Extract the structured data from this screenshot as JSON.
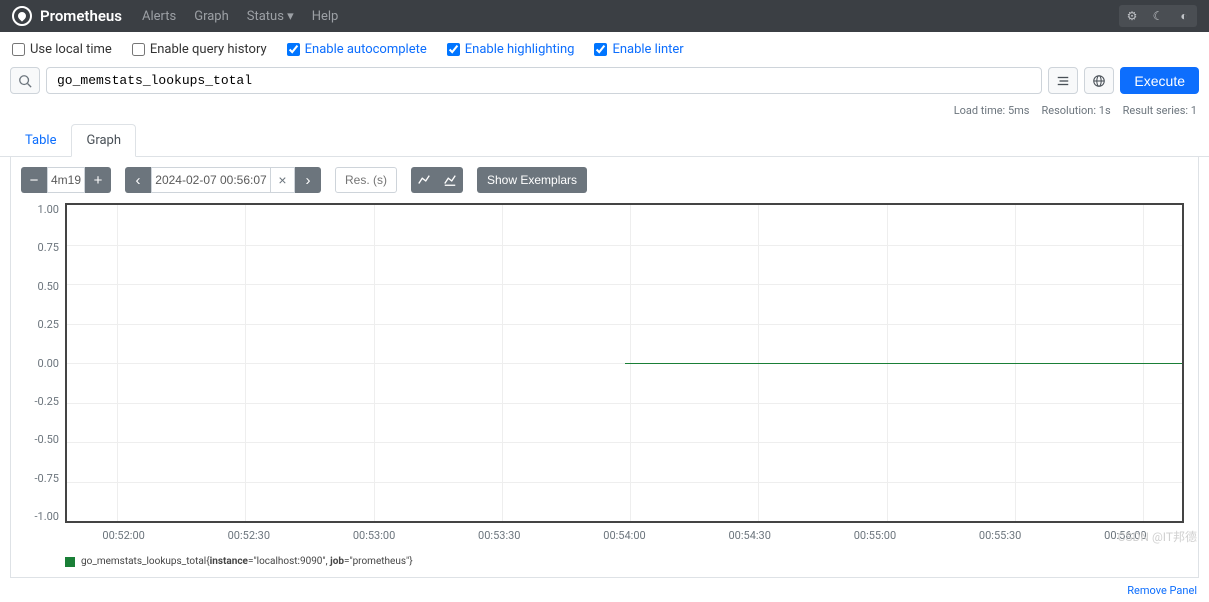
{
  "navbar": {
    "brand": "Prometheus",
    "links": [
      "Alerts",
      "Graph",
      "Status",
      "Help"
    ]
  },
  "options": {
    "use_local_time": {
      "label": "Use local time",
      "checked": false
    },
    "enable_query_history": {
      "label": "Enable query history",
      "checked": false
    },
    "enable_autocomplete": {
      "label": "Enable autocomplete",
      "checked": true
    },
    "enable_highlighting": {
      "label": "Enable highlighting",
      "checked": true
    },
    "enable_linter": {
      "label": "Enable linter",
      "checked": true
    }
  },
  "query": {
    "expression": "go_memstats_lookups_total",
    "execute_label": "Execute"
  },
  "stats": {
    "load_time": "Load time: 5ms",
    "resolution": "Resolution: 1s",
    "result_series": "Result series: 1"
  },
  "tabs": {
    "table": "Table",
    "graph": "Graph",
    "active": "graph"
  },
  "controls": {
    "range": "4m19",
    "end_time": "2024-02-07 00:56:07",
    "res_placeholder": "Res. (s)",
    "show_exemplars": "Show Exemplars"
  },
  "chart_data": {
    "type": "line",
    "title": "",
    "xlabel": "",
    "ylabel": "",
    "ylim": [
      -1.0,
      1.0
    ],
    "y_ticks": [
      "1.00",
      "0.75",
      "0.50",
      "0.25",
      "0.00",
      "-0.25",
      "-0.50",
      "-0.75",
      "-1.00"
    ],
    "x_ticks": [
      "00:52:00",
      "00:52:30",
      "00:53:00",
      "00:53:30",
      "00:54:00",
      "00:54:30",
      "00:55:00",
      "00:55:30",
      "00:56:00"
    ],
    "series": [
      {
        "name": "go_memstats_lookups_total{instance=\"localhost:9090\", job=\"prometheus\"}",
        "x": [
          "00:54:00",
          "00:54:30",
          "00:55:00",
          "00:55:30",
          "00:56:00",
          "00:56:07"
        ],
        "values": [
          0,
          0,
          0,
          0,
          0,
          0
        ],
        "color": "#1a7f37"
      }
    ]
  },
  "legend": {
    "metric_name": "go_memstats_lookups_total",
    "label_instance_key": "instance",
    "label_instance_val": "=\"localhost:9090\", ",
    "label_job_key": "job",
    "label_job_val": "=\"prometheus\"}"
  },
  "footer": {
    "remove_panel": "Remove Panel"
  },
  "watermark": "CSDN @IT邦德"
}
